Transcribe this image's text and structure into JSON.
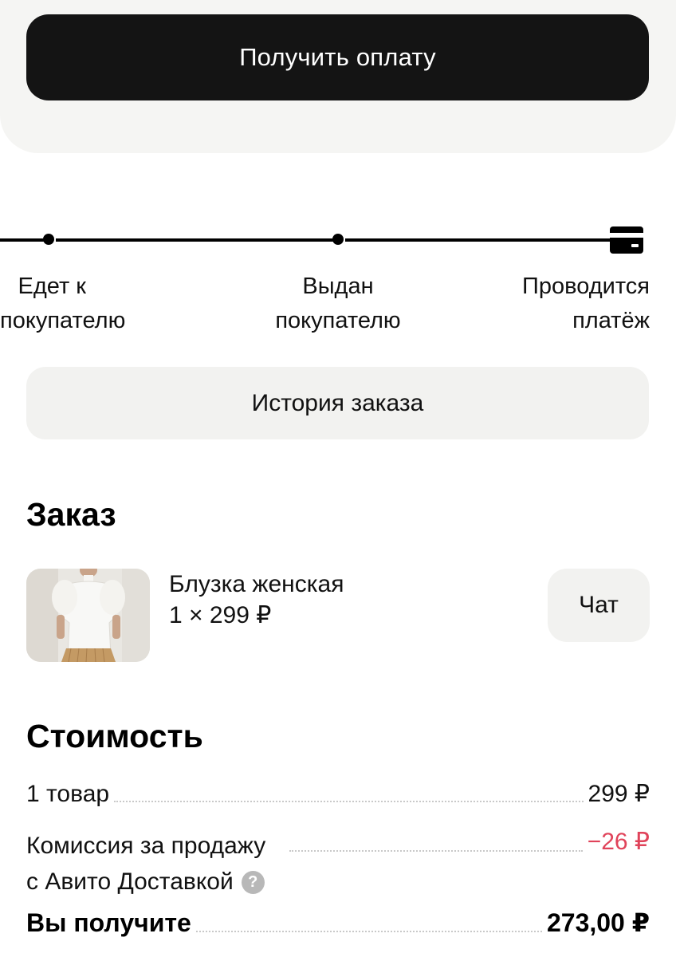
{
  "top": {
    "pay_button_label": "Получить оплату"
  },
  "timeline": {
    "steps": [
      {
        "line1": "Едет к",
        "line2": "покупателю"
      },
      {
        "line1": "Выдан",
        "line2": "покупателю"
      },
      {
        "line1": "Проводится",
        "line2": "платёж"
      }
    ],
    "icon": "credit-card-icon"
  },
  "history_button_label": "История заказа",
  "order": {
    "title": "Заказ",
    "item": {
      "name": "Блузка женская",
      "quantity_price": "1 × 299 ₽",
      "image_icon": "product-photo"
    },
    "chat_label": "Чат"
  },
  "cost": {
    "title": "Стоимость",
    "rows": [
      {
        "label": "1 товар",
        "value": "299 ₽"
      },
      {
        "label_line1": "Комиссия за продажу",
        "label_line2": "с Авито Доставкой",
        "value": "−26 ₽"
      },
      {
        "label": "Вы получите",
        "value": "273,00 ₽"
      }
    ],
    "help_icon": "?"
  },
  "colors": {
    "primary_button": "#141414",
    "secondary_button": "#f2f2f0",
    "negative": "#e0435a",
    "card_bg": "#f5f5f3"
  }
}
